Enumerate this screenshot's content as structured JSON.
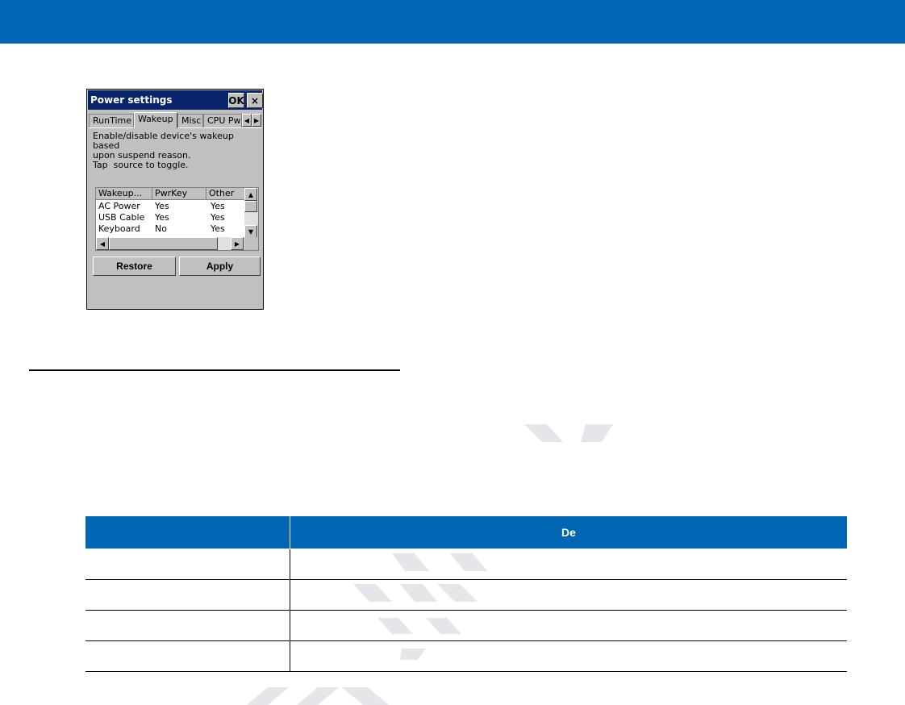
{
  "dialog": {
    "title": "Power settings",
    "ok_label": "OK",
    "close_label": "×",
    "tabs": [
      "RunTime",
      "Wakeup",
      "Misc",
      "CPU Pwr"
    ],
    "active_tab": "Wakeup",
    "description": [
      "Enable/disable device's wakeup based",
      "upon suspend reason.",
      "Tap  source to toggle."
    ],
    "list": {
      "columns": [
        "Wakeup...",
        "PwrKey",
        "Other"
      ],
      "rows": [
        [
          "AC Power",
          "Yes",
          "Yes"
        ],
        [
          "USB Cable",
          "Yes",
          "Yes"
        ],
        [
          "Keyboard",
          "No",
          "Yes"
        ]
      ]
    },
    "restore_label": "Restore",
    "apply_label": "Apply"
  },
  "table": {
    "header_description": "De",
    "row_count": 4
  },
  "colors": {
    "brand_blue": "#0066b3",
    "title_bar": "#08246b",
    "dialog_face": "#c0c0c0"
  }
}
